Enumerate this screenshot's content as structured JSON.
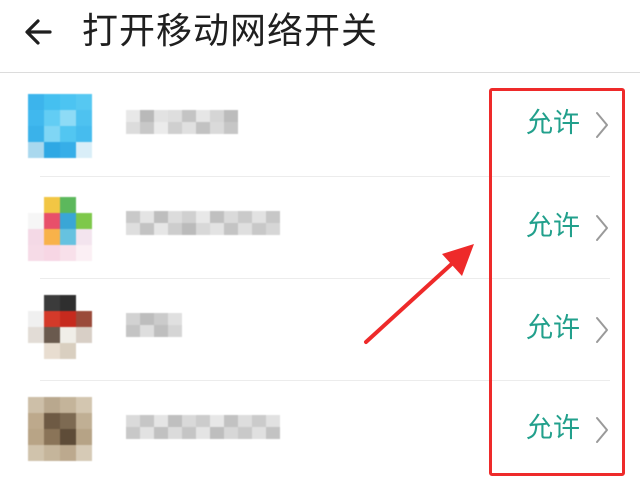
{
  "header": {
    "title": "打开移动网络开关",
    "back_icon": "arrow-left-icon"
  },
  "colors": {
    "accent": "#22a08c",
    "highlight": "#ee2a2a",
    "chevron": "#9a9a9a"
  },
  "apps": [
    {
      "permission_label": "允许"
    },
    {
      "permission_label": "允许"
    },
    {
      "permission_label": "允许"
    },
    {
      "permission_label": "允许"
    }
  ],
  "annotation": {
    "arrow_icon": "red-arrow-icon",
    "box": "red-highlight-box"
  }
}
